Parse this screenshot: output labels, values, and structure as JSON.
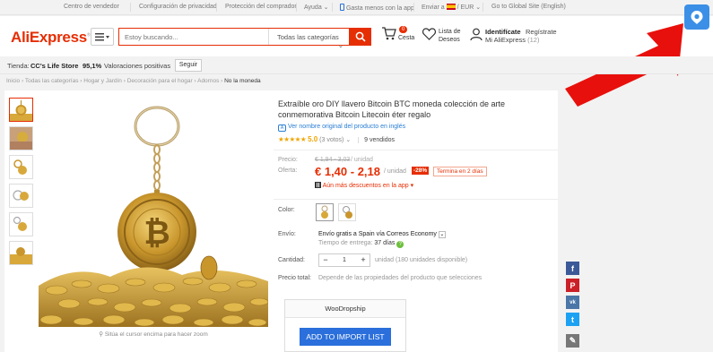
{
  "topbar": {
    "items": [
      "Centro de vendedor",
      "Configuración de privacidad",
      "Protección del comprador",
      "Ayuda",
      "Gasta menos con la app",
      "Enviar a",
      "/ EUR",
      "Go to Global Site (English)"
    ]
  },
  "header": {
    "logo": "AliExpress",
    "search_placeholder": "Estoy buscando...",
    "search_category": "Todas las categorías",
    "cart_count": "0",
    "cart_label": "Cesta",
    "wishlist_label": "Lista de Deseos",
    "account_sign_in": "Identifícate",
    "account_register": "Regístrate",
    "account_my": "Mi AliExpress",
    "account_count": "(12)"
  },
  "store": {
    "label": "Tienda:",
    "name": "CC's Life Store",
    "rating_pct": "95,1%",
    "rating_text": "Valoraciones positivas",
    "follow": "Seguir"
  },
  "breadcrumb": [
    "Inicio",
    "Todas las categorías",
    "Hogar y Jardín",
    "Decoración para el hogar",
    "Adornos",
    "No la moneda"
  ],
  "product": {
    "title": "Extraíble oro DIY llavero Bitcoin BTC moneda colección de arte conmemorativa Bitcoin Litecoin éter regalo",
    "translate_link": "Ver nombre original del producto en inglés",
    "score": "5.0",
    "votes": "(3 votos)",
    "sold": "9 vendidos",
    "zoom_hint": "Sitúa el cursor encima para hacer zoom"
  },
  "price": {
    "label_price": "Precio:",
    "old_price": "€ 1,94 - 3,03",
    "old_unit": "/ unidad",
    "label_offer": "Oferta:",
    "new_price": "€ 1,40 - 2,18",
    "unit": "/ unidad",
    "discount": "-28%",
    "ends": "Termina en 2 días",
    "app_discount": "Aún más descuentos en la app"
  },
  "options": {
    "label_color": "Color:",
    "label_shipping": "Envío:",
    "shipping_main": "Envío gratis a Spain vía Correos Economy",
    "delivery_label": "Tiempo de entrega:",
    "delivery_days": "37 días",
    "label_qty": "Cantidad:",
    "qty_minus": "−",
    "qty_value": "1",
    "qty_plus": "+",
    "qty_available": "unidad (180 unidades disponible)",
    "label_total": "Precio total:",
    "total_desc": "Depende de las propiedades del producto que selecciones"
  },
  "woodropship": {
    "title": "WooDropship",
    "button": "ADD TO IMPORT LIST"
  },
  "social": {
    "facebook": "f",
    "pinterest": "P",
    "vk": "vk",
    "twitter": "t",
    "edit": "✎"
  },
  "colors": {
    "accent": "#e62e04",
    "link": "#2a7ed3",
    "import_button": "#2a6fdb",
    "arrow": "#e8100c"
  }
}
